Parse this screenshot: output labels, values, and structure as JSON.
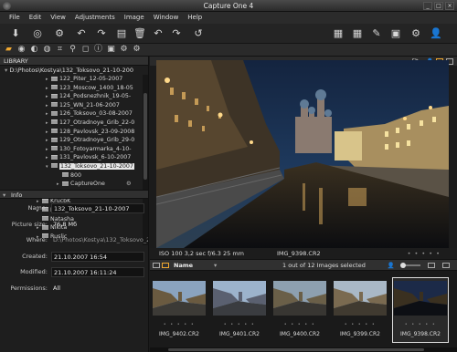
{
  "window": {
    "title": "Capture One 4"
  },
  "menu": [
    "File",
    "Edit",
    "View",
    "Adjustments",
    "Image",
    "Window",
    "Help"
  ],
  "viewer_toolbar": {
    "fit_label": "Fit"
  },
  "library": {
    "header": "LIBRARY",
    "path": "D:\\Photos\\Kostya\\132_Toksovo_21-10-200",
    "folders": [
      {
        "label": "122_Piter_12-05-2007",
        "level": 1,
        "arrow": "▸"
      },
      {
        "label": "123_Moscow_1400_18-05",
        "level": 1,
        "arrow": "▸"
      },
      {
        "label": "124_Podsnezhnik_19-05-",
        "level": 1,
        "arrow": "▸"
      },
      {
        "label": "125_WN_21-06-2007",
        "level": 1,
        "arrow": "▸"
      },
      {
        "label": "126_Toksovo_03-08-2007",
        "level": 1,
        "arrow": "▸"
      },
      {
        "label": "127_Otradnoye_Grib_22-0",
        "level": 1,
        "arrow": "▸"
      },
      {
        "label": "128_Pavlovsk_23-09-2008",
        "level": 1,
        "arrow": "▸"
      },
      {
        "label": "129_Otradnoye_Grib_29-0",
        "level": 1,
        "arrow": "▸"
      },
      {
        "label": "130_Fotoyarmarka_4-10-",
        "level": 1,
        "arrow": "▸"
      },
      {
        "label": "131_Pavlovsk_6-10-2007",
        "level": 1,
        "arrow": "▸"
      },
      {
        "label": "132_Toksovo_21-10-2007",
        "level": 1,
        "arrow": "▾",
        "selected": true
      },
      {
        "label": "800",
        "level": 2,
        "arrow": ""
      },
      {
        "label": "CaptureOne",
        "level": 2,
        "arrow": "▸"
      },
      {
        "label": "133_Symda_4-11-2007",
        "level": 1,
        "arrow": "▸"
      },
      {
        "label": "KrucbK",
        "level": 0,
        "arrow": "▸"
      },
      {
        "label": "MB",
        "level": 0,
        "arrow": "▸"
      },
      {
        "label": "Natasha",
        "level": 0,
        "arrow": ""
      },
      {
        "label": "Nikita",
        "level": 0,
        "arrow": "▸"
      },
      {
        "label": "Ruslic",
        "level": 0,
        "arrow": "▸"
      }
    ]
  },
  "info": {
    "header": "Info",
    "rows": [
      {
        "key": "Name:",
        "value": "132_Toksovo_21-10-2007",
        "boxed": true
      },
      {
        "key": "Picture size:",
        "value": "76,8 Мб",
        "boxed": false
      },
      {
        "key": "Where:",
        "value": "D:\\Photos\\Kostya\\132_Toksovo_2",
        "boxed": false,
        "muted": true
      },
      {
        "key": "Created:",
        "value": "21.10.2007 16:54",
        "boxed": true
      },
      {
        "key": "Modified:",
        "value": "21.10.2007 16:11:24",
        "boxed": true
      },
      {
        "key": "Permissions:",
        "value": "All",
        "boxed": false
      }
    ]
  },
  "photo_meta": {
    "exposure": "ISO 100   3,2 sec   f/6.3   25 mm",
    "filename": "IMG_9398.CR2",
    "rating": "• • • • •"
  },
  "browser": {
    "sort_label": "Name",
    "count_text": "1 out of 12 Images selected",
    "thumbnails": [
      {
        "name": "IMG_9402.CR2",
        "stars": "• • • • •",
        "selected": false
      },
      {
        "name": "IMG_9401.CR2",
        "stars": "• • • • •",
        "selected": false
      },
      {
        "name": "IMG_9400.CR2",
        "stars": "• • • • •",
        "selected": false
      },
      {
        "name": "IMG_9399.CR2",
        "stars": "• • • • •",
        "selected": false
      },
      {
        "name": "IMG_9398.CR2",
        "stars": "• • • • •",
        "selected": true
      }
    ]
  }
}
